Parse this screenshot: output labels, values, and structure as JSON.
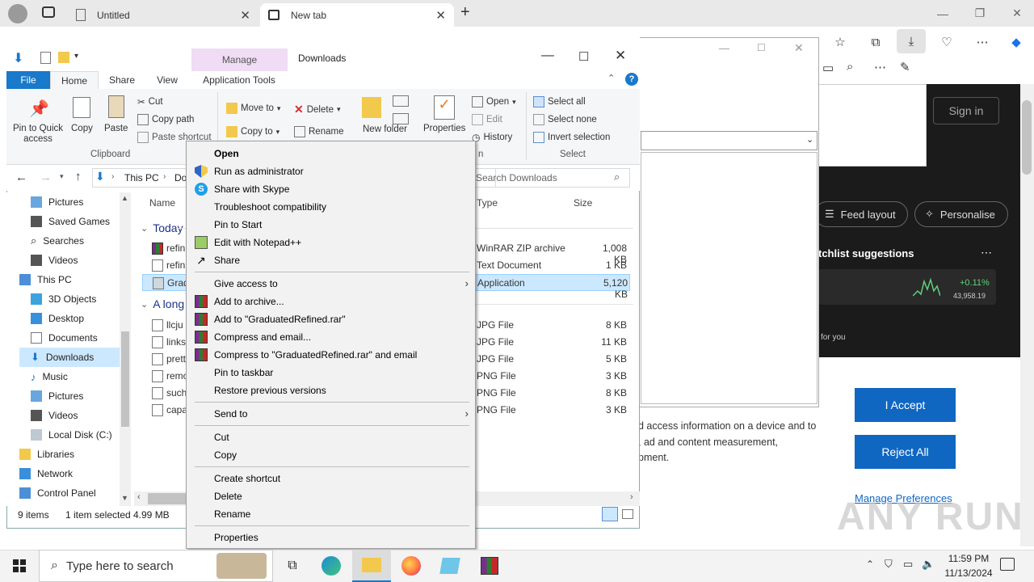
{
  "browser": {
    "tabs": [
      {
        "label": "Untitled"
      },
      {
        "label": "New tab"
      }
    ],
    "signin_label": "Sign in",
    "feed_layout": "Feed layout",
    "personalise": "Personalise",
    "watchlist_title": "tchlist suggestions",
    "stock_change": "+0.11%",
    "stock_value": "43,958.19",
    "for_you": "for you",
    "cookie_text": "d access information on a device and to\n, ad and content measurement,\npment.",
    "accept": "I Accept",
    "reject": "Reject All",
    "manage_prefs": "Manage Preferences",
    "watermark": "ANY RUN"
  },
  "explorer": {
    "title": "Downloads",
    "manage_label": "Manage",
    "tabs": {
      "file": "File",
      "home": "Home",
      "share": "Share",
      "view": "View",
      "app_tools": "Application Tools"
    },
    "ribbon": {
      "pin_quick": "Pin to Quick access",
      "copy": "Copy",
      "paste": "Paste",
      "cut": "Cut",
      "copy_path": "Copy path",
      "paste_shortcut": "Paste shortcut",
      "clipboard": "Clipboard",
      "move_to": "Move to",
      "copy_to": "Copy to",
      "delete": "Delete",
      "rename": "Rename",
      "new_folder": "New folder",
      "properties": "Properties",
      "open": "Open",
      "edit": "Edit",
      "history": "History",
      "open_group": "n",
      "select_all": "Select all",
      "select_none": "Select none",
      "invert": "Invert selection",
      "select": "Select"
    },
    "address": {
      "this_pc": "This PC",
      "crumb": "Do"
    },
    "search_placeholder": "Search Downloads",
    "nav": [
      {
        "label": "Pictures"
      },
      {
        "label": "Saved Games"
      },
      {
        "label": "Searches"
      },
      {
        "label": "Videos"
      },
      {
        "label": "This PC"
      },
      {
        "label": "3D Objects"
      },
      {
        "label": "Desktop"
      },
      {
        "label": "Documents"
      },
      {
        "label": "Downloads"
      },
      {
        "label": "Music"
      },
      {
        "label": "Pictures"
      },
      {
        "label": "Videos"
      },
      {
        "label": "Local Disk (C:)"
      },
      {
        "label": "Libraries"
      },
      {
        "label": "Network"
      },
      {
        "label": "Control Panel"
      }
    ],
    "columns": {
      "name": "Name",
      "type": "Type",
      "size": "Size"
    },
    "groups": {
      "today": "Today",
      "long_ago": "A long"
    },
    "files_today": [
      {
        "name": "refin",
        "type": "WinRAR ZIP archive",
        "size": "1,008 KB"
      },
      {
        "name": "refin",
        "type": "Text Document",
        "size": "1 KB"
      },
      {
        "name": "Grad",
        "type": "Application",
        "size": "5,120 KB"
      }
    ],
    "files_old": [
      {
        "name": "llcju",
        "type": "JPG File",
        "size": "8 KB"
      },
      {
        "name": "links",
        "type": "JPG File",
        "size": "11 KB"
      },
      {
        "name": "prett",
        "type": "JPG File",
        "size": "5 KB"
      },
      {
        "name": "remo",
        "type": "PNG File",
        "size": "3 KB"
      },
      {
        "name": "such",
        "type": "PNG File",
        "size": "8 KB"
      },
      {
        "name": "capa",
        "type": "PNG File",
        "size": "3 KB"
      }
    ],
    "status": {
      "items": "9 items",
      "selected": "1 item selected",
      "size": "4.99 MB"
    }
  },
  "context_menu": {
    "open": "Open",
    "run_admin": "Run as administrator",
    "skype": "Share with Skype",
    "troubleshoot": "Troubleshoot compatibility",
    "pin_start": "Pin to Start",
    "notepad": "Edit with Notepad++",
    "share": "Share",
    "give_access": "Give access to",
    "add_archive": "Add to archive...",
    "add_rar": "Add to \"GraduatedRefined.rar\"",
    "compress_email": "Compress and email...",
    "compress_rar_email": "Compress to \"GraduatedRefined.rar\" and email",
    "pin_taskbar": "Pin to taskbar",
    "restore": "Restore previous versions",
    "send_to": "Send to",
    "cut": "Cut",
    "copy": "Copy",
    "create_shortcut": "Create shortcut",
    "delete": "Delete",
    "rename": "Rename",
    "properties": "Properties"
  },
  "taskbar": {
    "search_placeholder": "Type here to search",
    "time": "11:59 PM",
    "date": "11/13/2024"
  },
  "colors": {
    "accent": "#1067c2",
    "selection": "#cce8ff",
    "file_tab": "#1979ca"
  }
}
